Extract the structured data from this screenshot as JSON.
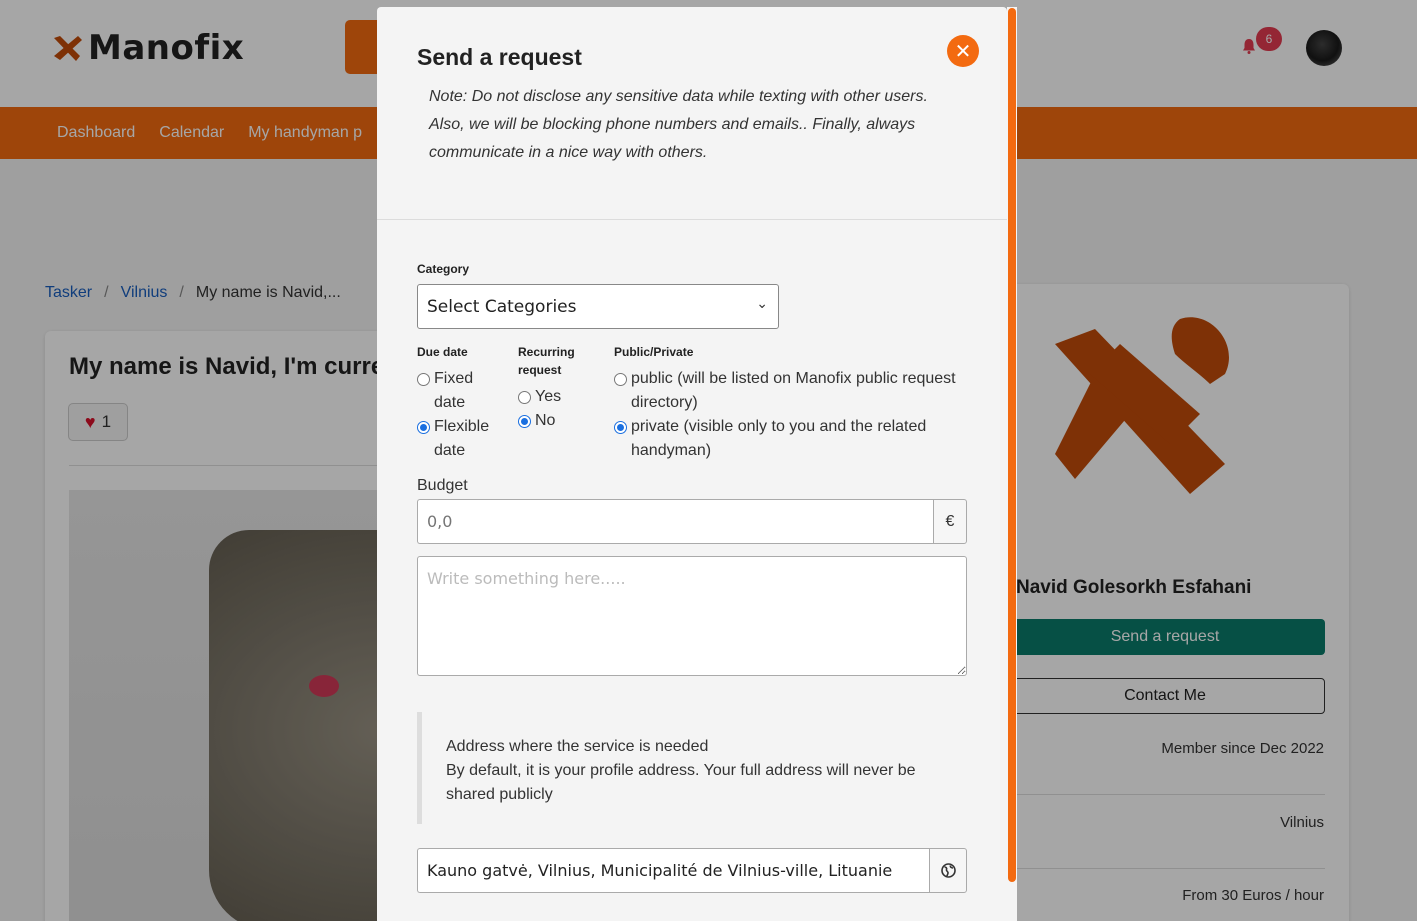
{
  "app": {
    "brand": "Manofix",
    "notification_count": "6"
  },
  "nav": {
    "items": [
      "Dashboard",
      "Calendar",
      "My handyman p"
    ]
  },
  "breadcrumb": {
    "items": [
      "Tasker",
      "Vilnius",
      "My name is Navid,..."
    ]
  },
  "post": {
    "title": "My name is Navid, I'm curre",
    "likes": "1"
  },
  "profile": {
    "name": "Navid Golesorkh Esfahani",
    "send_request_label": "Send a request",
    "contact_label": "Contact Me",
    "member_since": "Member since Dec 2022",
    "city": "Vilnius",
    "rate": "From 30 Euros / hour"
  },
  "modal": {
    "title": "Send a request",
    "close_icon": "close-icon",
    "note": "Note: Do not disclose any sensitive data while texting with other users. Also, we will be blocking phone numbers and emails.. Finally, always communicate in a nice way with others.",
    "category_label": "Category",
    "category_value": "Select Categories",
    "due_date_label": "Due date",
    "due_options": [
      {
        "label": "Fixed date",
        "checked": false
      },
      {
        "label": "Flexible date",
        "checked": true
      }
    ],
    "recurring_label": "Recurring request",
    "recurring_options": [
      {
        "label": "Yes",
        "checked": false
      },
      {
        "label": "No",
        "checked": true
      }
    ],
    "visibility_label": "Public/Private",
    "visibility_options": [
      {
        "label": "public (will be listed on Manofix public request directory)",
        "checked": false
      },
      {
        "label": "private (visible only to you and the related handyman)",
        "checked": true
      }
    ],
    "budget_label": "Budget",
    "budget_placeholder": "0,0",
    "currency_symbol": "€",
    "message_placeholder": "Write something here.....",
    "address_title": "Address where the service is needed",
    "address_note": "By default, it is your profile address. Your full address will never be shared publicly",
    "address_value": "Kauno gatvė, Vilnius, Municipalité de Vilnius-ville, Lituanie"
  },
  "colors": {
    "brand_orange": "#f36a10",
    "logo_brown": "#c24c0a",
    "teal": "#0a7b6a",
    "radio_blue": "#1a6fe0"
  }
}
